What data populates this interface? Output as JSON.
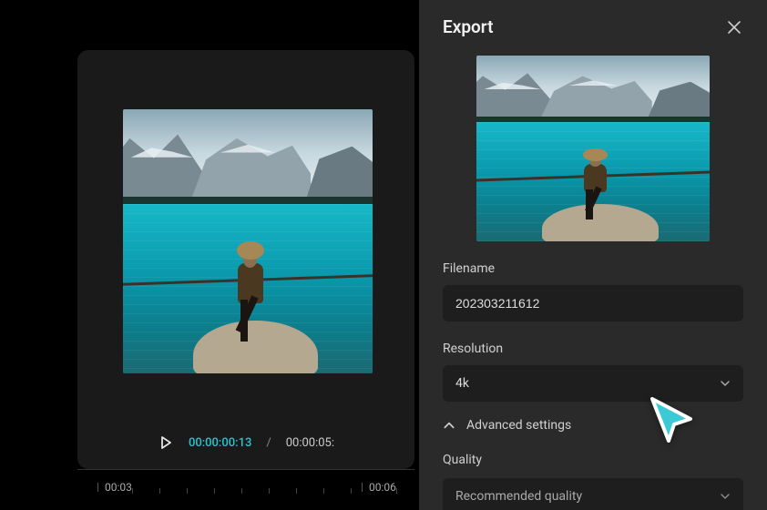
{
  "preview": {
    "time_current": "00:00:00:13",
    "time_total": "00:00:05:",
    "separator": "/"
  },
  "timeline": {
    "tick_03": "00:03",
    "tick_06": "00:06"
  },
  "export": {
    "title": "Export",
    "filename_label": "Filename",
    "filename_value": "202303211612",
    "resolution_label": "Resolution",
    "resolution_value": "4k",
    "advanced_label": "Advanced settings",
    "quality_label": "Quality",
    "quality_value": "Recommended quality"
  }
}
